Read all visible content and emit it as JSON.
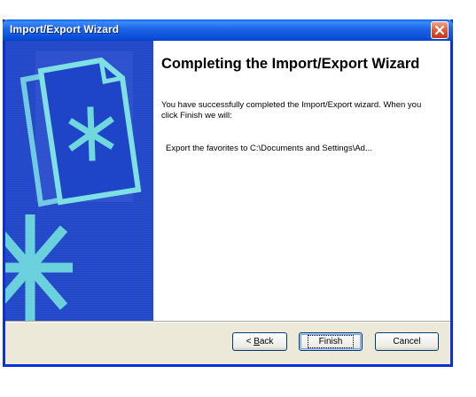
{
  "window": {
    "title": "Import/Export Wizard",
    "close_icon": "close-icon"
  },
  "content": {
    "heading": "Completing the Import/Export Wizard",
    "description": "You have successfully completed the Import/Export wizard.  When you click Finish we will:",
    "summary_line": "Export the favorites to C:\\Documents and Settings\\Ad..."
  },
  "buttons": {
    "back_prefix": "< ",
    "back_mnemonic": "B",
    "back_rest": "ack",
    "finish": "Finish",
    "cancel": "Cancel"
  },
  "colors": {
    "panel_blue": "#1e44c8",
    "accent_teal": "#5fd1d6",
    "titlebar_blue": "#0a4fd8",
    "dialog_face": "#ece9d8"
  }
}
